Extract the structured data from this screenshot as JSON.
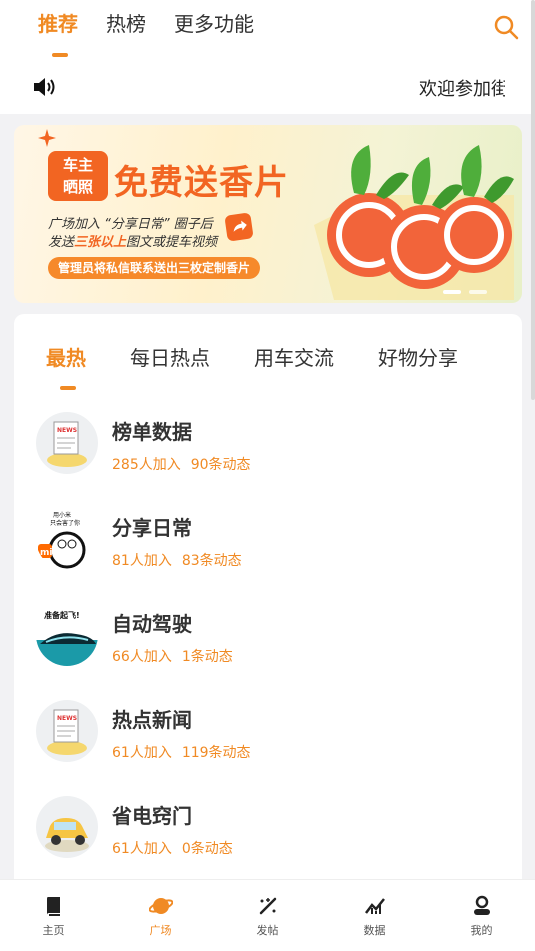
{
  "top_tabs": [
    "推荐",
    "热榜",
    "更多功能"
  ],
  "notice": {
    "text": "欢迎参加街"
  },
  "banner": {
    "badge": "车主\n晒照",
    "title": "免费送香片",
    "line1": "广场加入 “分享日常” 圈子后",
    "line2_pre": "发送",
    "line2_hl": "三张以上",
    "line2_post": "图文或提车视频",
    "pill": "管理员将私信联系送出三枚定制香片"
  },
  "category_tabs": [
    "最热",
    "每日热点",
    "用车交流",
    "好物分享"
  ],
  "circles": [
    {
      "name": "榜单数据",
      "members": "285人加入",
      "posts": "90条动态",
      "avatar": "newspaper-icon"
    },
    {
      "name": "分享日常",
      "members": "81人加入",
      "posts": "83条动态",
      "avatar": "doraemon-mi-icon",
      "avatar_text": "用小米\n只会害了你"
    },
    {
      "name": "自动驾驶",
      "members": "66人加入",
      "posts": "1条动态",
      "avatar": "car-icon",
      "avatar_text": "准备起飞!"
    },
    {
      "name": "热点新闻",
      "members": "61人加入",
      "posts": "119条动态",
      "avatar": "newspaper-icon"
    },
    {
      "name": "省电窍门",
      "members": "61人加入",
      "posts": "0条动态",
      "avatar": "yellow-car-icon"
    }
  ],
  "bottom_nav": [
    {
      "label": "主页",
      "icon": "book-icon"
    },
    {
      "label": "广场",
      "icon": "planet-icon"
    },
    {
      "label": "发帖",
      "icon": "sparkle-pen-icon"
    },
    {
      "label": "数据",
      "icon": "chart-icon"
    },
    {
      "label": "我的",
      "icon": "user-icon"
    }
  ],
  "colors": {
    "accent": "#f08a24",
    "banner_orange": "#f26522"
  }
}
